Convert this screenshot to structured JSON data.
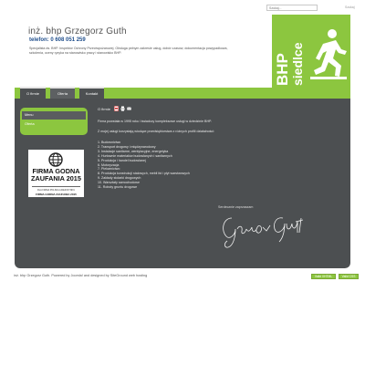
{
  "search": {
    "value": "Szukaj...",
    "button": "Szukaj"
  },
  "header": {
    "title": "inż. bhp Grzegorz Guth",
    "phone": "telefon: 0 608 051 259",
    "description": "Specjalista ds. BHP. Inspektor Ochrony Przeciwpożarowej. Obsługa pełnym zakresie usług, dobór czasów, dokumentacja powypadkowa, szkolenia, oceny ryzyka na stanowisko pracy i stanowisko BHP."
  },
  "logo": {
    "line1": "BHP",
    "line2": "siedlce"
  },
  "nav": {
    "tabs": [
      "O firmie",
      "Oferta",
      "Kontakt"
    ]
  },
  "sidebar": {
    "items": [
      "Menu",
      "Oferta"
    ]
  },
  "badge": {
    "title": "FIRMA GODNA ZAUFANIA 2015",
    "sub": "DLA FIRMA POLSKA LIDER RYNKU",
    "sub2": "FIRMA GODNA ZAUFANIA 2015"
  },
  "content": {
    "title": "O firmie",
    "intro": "Firma powstała w 1995 roku i świadczy kompleksowe usługi w dziedzinie BHP.",
    "subhead": "Z mojej usługi korzystają wiodące przedsiębiorstwa z różnych profili działalności:",
    "list": [
      "1. Budownictwo",
      "2. Transport drogowy i międzynarodowy",
      "3. Instalacje sanitarne, wentylacyjne, energetyka",
      "4. Hurtownie materiałów budowlanych i sanitarnych",
      "5. Produkcja i handel budowlanej",
      "6. Motoryzacja",
      "7. Piekarnictwo",
      "8. Produkcja konstrukcji stalowych, mebli itd i płyt warstwowych",
      "9. Zakłady stolarki drogowych",
      "10. Warsztaty samochodowe",
      "11. Roboty gruntu drogowe"
    ],
    "signature_label": "Serdecznie zaprzaszam"
  },
  "footer": {
    "text": "inż. bhp Grzegorz Guth. Powered by Joomla! and designed by SiteGround web hosting",
    "btn1": "Valid XHTML",
    "btn2": "Valid CSS"
  },
  "colors": {
    "accent": "#8cc63f",
    "dark": "#4c4f51"
  }
}
